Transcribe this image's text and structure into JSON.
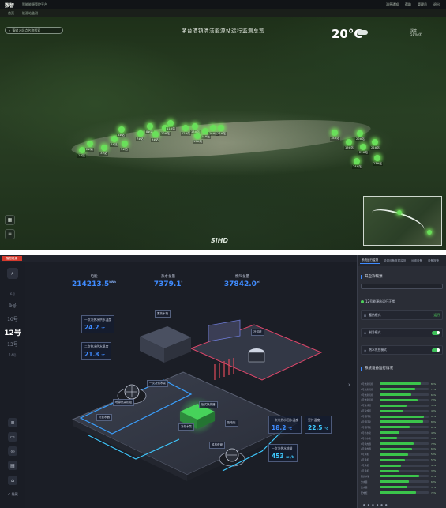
{
  "panel1": {
    "logo": "数智",
    "app_title": "智能能源管控平台",
    "header_right": [
      "消息通知",
      "帮助",
      "管理员",
      "退出"
    ],
    "tabs": [
      "首页",
      "能源站监测"
    ],
    "search_placeholder": "请输入站点名称搜索",
    "map_title": "茅台酒镇清洁能源站运行监测总览",
    "weather": {
      "temperature": "20°C",
      "humidity_line1": "湿度",
      "humidity_line2": "51%  优"
    },
    "station_labels": [
      "1#站",
      "2#站",
      "3#站",
      "4#站",
      "5#站",
      "6#站",
      "7#站",
      "8#站",
      "9#站",
      "10#站",
      "11#站",
      "12#站",
      "13#站",
      "14#站",
      "15#站",
      "16#站",
      "17#站",
      "18#站",
      "19#站",
      "20#站",
      "21#站",
      "22#站",
      "23#站",
      "24#站"
    ],
    "brand": "SIHD",
    "colors": {
      "station": "#69e05a",
      "header": "#111417"
    }
  },
  "panel2": {
    "logo": "智慧能源",
    "floors": {
      "label_top": "6号",
      "items": [
        "9号",
        "10号",
        "12号",
        "13号",
        "14号"
      ],
      "active": "12号"
    },
    "bottom_label": "< 隐藏",
    "stats": [
      {
        "label": "电能",
        "value": "214213.5",
        "unit": "kWh"
      },
      {
        "label": "热水总量",
        "value": "7379.1",
        "unit": "t"
      },
      {
        "label": "燃气总量",
        "value": "37842.0",
        "unit": "m³"
      }
    ],
    "readouts": [
      {
        "label": "一次冷热水供水温度",
        "value": "24.2",
        "unit": "℃"
      },
      {
        "label": "二次热水供水温度",
        "value": "21.8",
        "unit": "℃"
      },
      {
        "label": "一次冷热水回水温度",
        "value": "18.2",
        "unit": "℃"
      },
      {
        "label": "室外温度",
        "value": "22.5",
        "unit": "℃"
      },
      {
        "label": "一次冷热水流量",
        "value": "453",
        "unit": "m³/h"
      }
    ],
    "equipment_tags": [
      "蓄热水箱",
      "冷却塔",
      "一次冷热水泵",
      "地源热泵机组",
      "板式换热器",
      "配电柜",
      "冷却水泵",
      "分集水器",
      "风机盘管"
    ],
    "right_panel": {
      "tabs": [
        "系统运行监测",
        "能源设备数据监测",
        "运维设备",
        "设备报警"
      ],
      "active_tab": "系统运行监测",
      "section_mode": "开启冷暖源",
      "status_text": "12号能源站运行正常",
      "controls": [
        {
          "label": "蓄热模式",
          "state": "运行"
        },
        {
          "label": "制冷模式",
          "state": "on"
        },
        {
          "label": "热水供应模式",
          "state": "on"
        }
      ],
      "section_equipment": "系统设备运行情况",
      "equipment_bars": [
        {
          "label": "1号热泵机组",
          "value": "84%",
          "level": 0.84
        },
        {
          "label": "2号热泵机组",
          "value": "72%",
          "level": 0.72
        },
        {
          "label": "3号热泵机组",
          "value": "65%",
          "level": 0.65
        },
        {
          "label": "4号热泵机组",
          "value": "78%",
          "level": 0.78
        },
        {
          "label": "1号冷却塔",
          "value": "55%",
          "level": 0.55
        },
        {
          "label": "2号冷却塔",
          "value": "48%",
          "level": 0.48
        },
        {
          "label": "1号循环泵",
          "value": "91%",
          "level": 0.91
        },
        {
          "label": "2号循环泵",
          "value": "88%",
          "level": 0.88
        },
        {
          "label": "3号循环泵",
          "value": "62%",
          "level": 0.62
        },
        {
          "label": "1号补水泵",
          "value": "40%",
          "level": 0.4
        },
        {
          "label": "2号补水泵",
          "value": "36%",
          "level": 0.36
        },
        {
          "label": "1号换热器",
          "value": "70%",
          "level": 0.7
        },
        {
          "label": "2号换热器",
          "value": "66%",
          "level": 0.66
        },
        {
          "label": "1号风机",
          "value": "58%",
          "level": 0.58
        },
        {
          "label": "2号风机",
          "value": "52%",
          "level": 0.52
        },
        {
          "label": "3号风机",
          "value": "44%",
          "level": 0.44
        },
        {
          "label": "4号风机",
          "value": "39%",
          "level": 0.39
        },
        {
          "label": "蓄热水箱",
          "value": "81%",
          "level": 0.81
        },
        {
          "label": "分水器",
          "value": "60%",
          "level": 0.6
        },
        {
          "label": "集水器",
          "value": "57%",
          "level": 0.57
        },
        {
          "label": "配电柜",
          "value": "74%",
          "level": 0.74
        }
      ]
    },
    "colors": {
      "value_blue": "#3f8bff",
      "value_cyan": "#3ec9ff",
      "bar_green": "#3bc44b"
    }
  }
}
